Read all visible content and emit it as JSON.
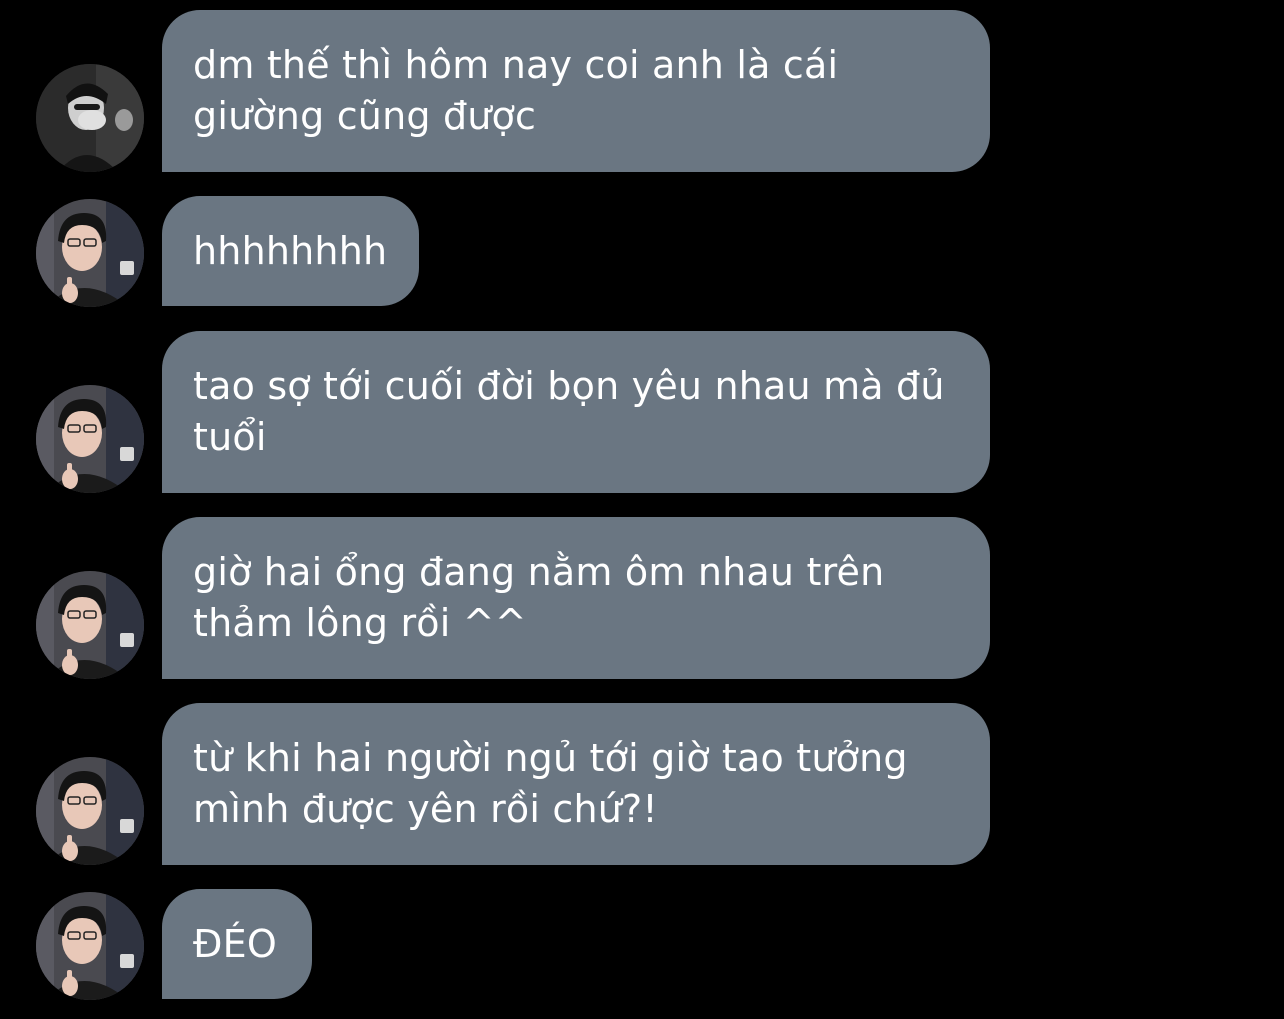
{
  "colors": {
    "background": "#000000",
    "bubble": "#6a7682",
    "text": "#ffffff"
  },
  "messages": [
    {
      "text": "dm thế thì hôm nay coi anh là cái\ngiường cũng được",
      "avatar": "avatar-hand-over-face"
    },
    {
      "text": "hhhhhhhh",
      "avatar": "avatar-thumbs-up"
    },
    {
      "text": "tao sợ tới cuối đời bọn yêu nhau mà đủ\ntuổi",
      "avatar": "avatar-thumbs-up"
    },
    {
      "text": "giờ hai ổng đang nằm ôm nhau trên\nthảm lông rồi ^^",
      "avatar": "avatar-thumbs-up"
    },
    {
      "text": "từ khi hai người ngủ tới giờ tao tưởng\nmình được yên rồi chứ?!",
      "avatar": "avatar-thumbs-up"
    },
    {
      "text": "ĐÉO",
      "avatar": "avatar-thumbs-up"
    }
  ]
}
